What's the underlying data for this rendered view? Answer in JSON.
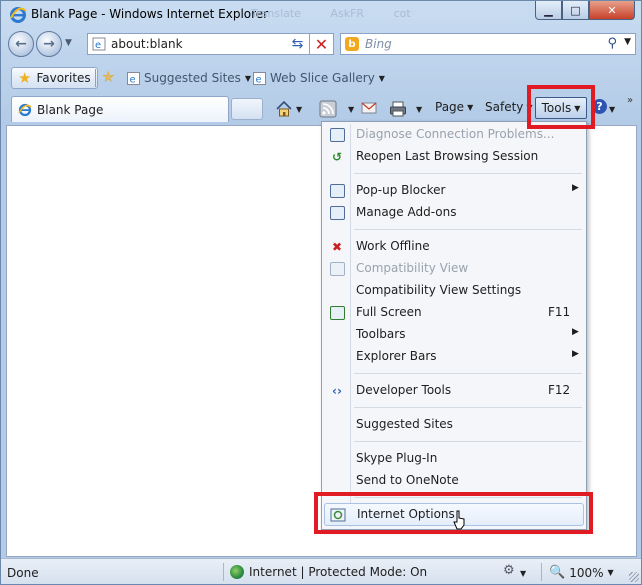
{
  "window": {
    "title": "Blank Page - Windows Internet Explorer",
    "ghost_tabs": [
      "Translate",
      "AskFR",
      "cot"
    ]
  },
  "nav": {
    "address": "about:blank",
    "search_placeholder": "Bing"
  },
  "favorites_bar": {
    "favorites_label": "Favorites",
    "links": [
      {
        "label": "Suggested Sites"
      },
      {
        "label": "Web Slice Gallery"
      }
    ]
  },
  "command_bar": {
    "tab_label": "Blank Page",
    "page_label": "Page",
    "safety_label": "Safety",
    "tools_label": "Tools"
  },
  "tools_menu": {
    "items": [
      {
        "label": "Diagnose Connection Problems...",
        "icon": "diagnose-icon",
        "disabled": true
      },
      {
        "label": "Reopen Last Browsing Session",
        "icon": "reopen-icon"
      },
      {
        "label": "Pop-up Blocker",
        "icon": "popup-blocker-icon",
        "submenu": true
      },
      {
        "label": "Manage Add-ons",
        "icon": "addons-icon"
      },
      {
        "label": "Work Offline",
        "icon": "work-offline-icon"
      },
      {
        "label": "Compatibility View",
        "icon": "compatibility-icon",
        "disabled": true
      },
      {
        "label": "Compatibility View Settings"
      },
      {
        "label": "Full Screen",
        "icon": "fullscreen-icon",
        "shortcut": "F11"
      },
      {
        "label": "Toolbars",
        "submenu": true
      },
      {
        "label": "Explorer Bars",
        "submenu": true
      },
      {
        "label": "Developer Tools",
        "icon": "developer-tools-icon",
        "shortcut": "F12"
      },
      {
        "label": "Suggested Sites"
      },
      {
        "label": "Skype Plug-In"
      },
      {
        "label": "Send to OneNote"
      },
      {
        "label": "Internet Options",
        "icon": "internet-options-icon"
      }
    ]
  },
  "status_bar": {
    "left": "Done",
    "zone": "Internet | Protected Mode: On",
    "zoom": "100%"
  },
  "colors": {
    "highlight": "#e01b24",
    "window_frame": "#b3cbe7"
  }
}
